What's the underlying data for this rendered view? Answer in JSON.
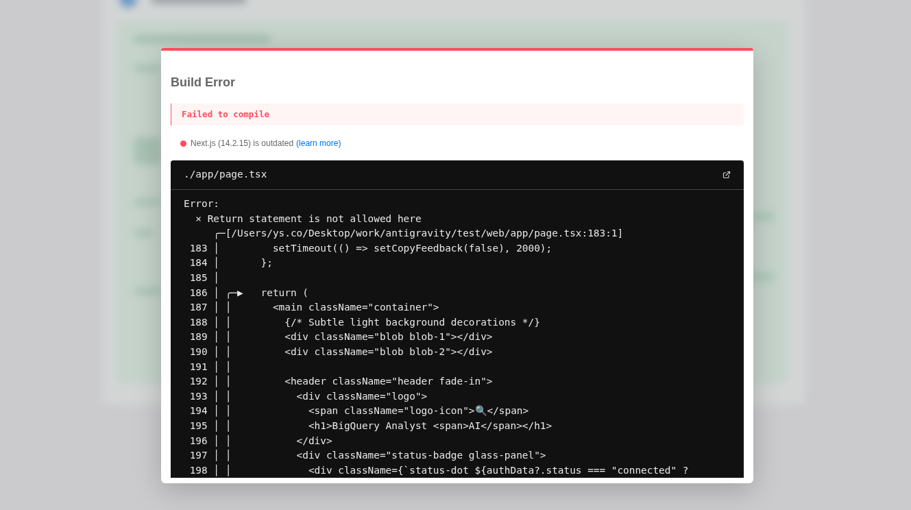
{
  "dialog": {
    "title": "Build Error",
    "message": "Failed to compile",
    "version_notice": {
      "text": "Next.js (14.2.15) is outdated",
      "link": "(learn more)"
    },
    "source": {
      "file": "./app/page.tsx",
      "lines": [
        {
          "kind": "message",
          "text": "Error:"
        },
        {
          "kind": "message",
          "text": "  × Return statement is not allowed here"
        },
        {
          "kind": "message",
          "text": "     ╭─[/Users/ys.co/Desktop/work/antigravity/test/web/app/page.tsx:183:1]"
        },
        {
          "kind": "source",
          "number": "183",
          "text": " │         setTimeout(() => setCopyFeedback(false), 2000);"
        },
        {
          "kind": "source",
          "number": "184",
          "text": " │       };"
        },
        {
          "kind": "source",
          "number": "185",
          "text": " │"
        },
        {
          "kind": "source",
          "number": "186",
          "text": " │ ╭─▶   return ("
        },
        {
          "kind": "source",
          "number": "187",
          "text": " │ │       <main className=\"container\">"
        },
        {
          "kind": "source",
          "number": "188",
          "text": " │ │         {/* Subtle light background decorations */}"
        },
        {
          "kind": "source",
          "number": "189",
          "text": " │ │         <div className=\"blob blob-1\"></div>"
        },
        {
          "kind": "source",
          "number": "190",
          "text": " │ │         <div className=\"blob blob-2\"></div>"
        },
        {
          "kind": "source",
          "number": "191",
          "text": " │ │"
        },
        {
          "kind": "source",
          "number": "192",
          "text": " │ │         <header className=\"header fade-in\">"
        },
        {
          "kind": "source",
          "number": "193",
          "text": " │ │           <div className=\"logo\">"
        },
        {
          "kind": "source",
          "number": "194",
          "text": " │ │             <span className=\"logo-icon\">🔍</span>"
        },
        {
          "kind": "source",
          "number": "195",
          "text": " │ │             <h1>BigQuery Analyst <span>AI</span></h1>"
        },
        {
          "kind": "source",
          "number": "196",
          "text": " │ │           </div>"
        },
        {
          "kind": "source",
          "number": "197",
          "text": " │ │           <div className=\"status-badge glass-panel\">"
        },
        {
          "kind": "source",
          "number": "198",
          "text": " │ │             <div className={`status-dot ${authData?.status === \"connected\" ?"
        }
      ]
    }
  }
}
